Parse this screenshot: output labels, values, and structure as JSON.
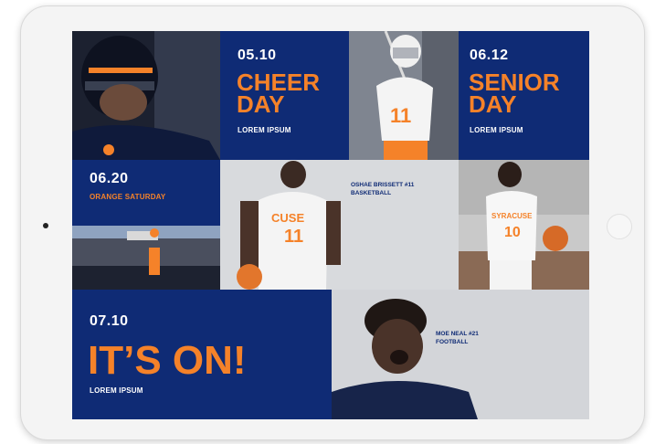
{
  "tiles": {
    "cheer": {
      "date": "05.10",
      "title_line1": "CHEER",
      "title_line2": "DAY",
      "sub": "LOREM IPSUM"
    },
    "senior": {
      "date": "06.12",
      "title_line1": "SENIOR",
      "title_line2": "DAY",
      "sub": "LOREM IPSUM"
    },
    "orange_saturday": {
      "date": "06.20",
      "sub": "ORANGE SATURDAY"
    },
    "its_on": {
      "date": "07.10",
      "title": "IT’S ON!",
      "sub": "LOREM IPSUM"
    }
  },
  "captions": {
    "basketball": {
      "line1": "OSHAE BRISSETT #11",
      "line2": "BASKETBALL"
    },
    "football": {
      "line1": "MOE NEAL #21",
      "line2": "FOOTBALL"
    }
  },
  "jerseys": {
    "lacrosse": "11",
    "basketball_wordmark": "CUSE",
    "basketball_number": "11",
    "womens_wordmark": "SYRACUSE",
    "womens_number": "10"
  },
  "colors": {
    "navy": "#0f2b75",
    "orange": "#f58229",
    "white": "#ffffff"
  },
  "icons": {
    "camera": "camera-dot",
    "home_button": "home-button-ring"
  }
}
